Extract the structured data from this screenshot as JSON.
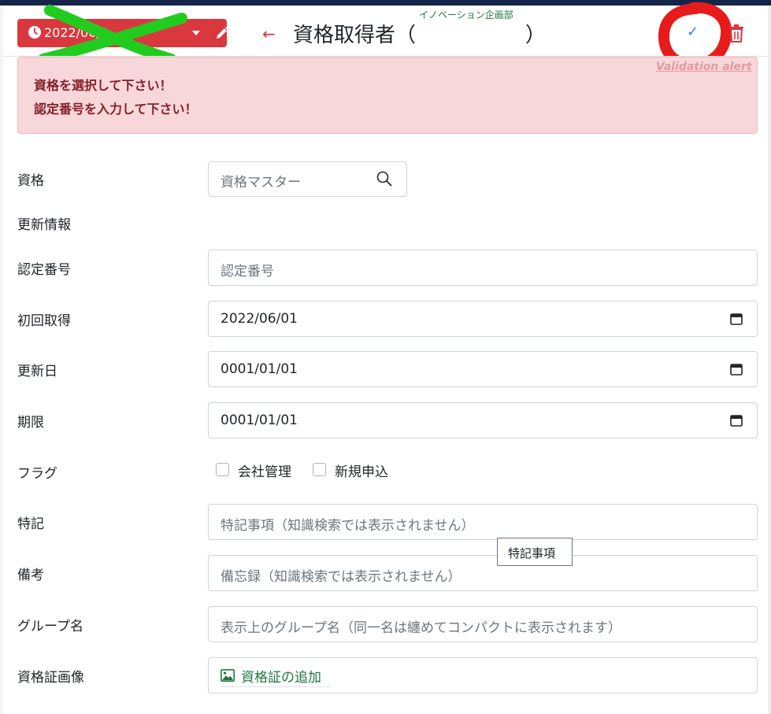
{
  "header": {
    "department": "イノベーション企画部",
    "date_button_label": "2022/06/1",
    "title": "資格取得者（",
    "title_close": "）",
    "back_icon": "arrow-left-icon",
    "confirm_icon": "check-icon",
    "delete_icon": "trash-icon"
  },
  "alert": {
    "link_label": "Validation alert",
    "messages": [
      "資格を選択して下さい！",
      "認定番号を入力して下さい！"
    ]
  },
  "form": {
    "qualification": {
      "label": "資格",
      "placeholder": "資格マスター"
    },
    "renewal_info": {
      "label": "更新情報"
    },
    "cert_number": {
      "label": "認定番号",
      "placeholder": "認定番号"
    },
    "first_acquired": {
      "label": "初回取得",
      "value": "2022/06/01"
    },
    "renewal_date": {
      "label": "更新日",
      "value": "0001/01/01"
    },
    "expiry": {
      "label": "期限",
      "value": "0001/01/01"
    },
    "flags": {
      "label": "フラグ",
      "options": [
        "会社管理",
        "新規申込"
      ]
    },
    "special_notes": {
      "label": "特記",
      "placeholder": "特記事項（知識検索では表示されません）"
    },
    "tooltip": "特記事項",
    "remarks": {
      "label": "備考",
      "placeholder": "備忘録（知識検索では表示されません）"
    },
    "group_name": {
      "label": "グループ名",
      "placeholder": "表示上のグループ名（同一名は纏めてコンパクトに表示されます）"
    },
    "cert_image": {
      "label": "資格証画像",
      "link": "資格証の追加"
    }
  },
  "colors": {
    "accent_red": "#d9383f",
    "alert_bg": "#f8d7da",
    "alert_text": "#842029",
    "link_green": "#22753f",
    "check_blue": "#2f7de1",
    "annotation_green": "#22cc1e",
    "annotation_red": "#e81b1b"
  }
}
